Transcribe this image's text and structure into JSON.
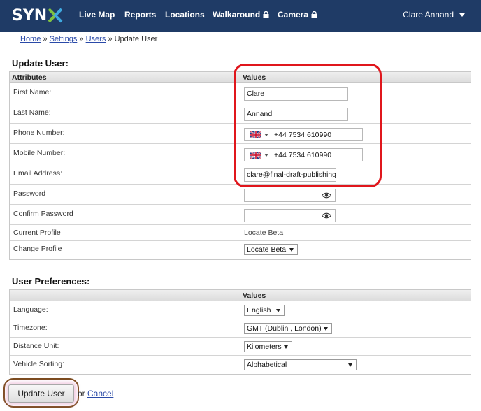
{
  "nav": {
    "logo_text": "SYN",
    "items": [
      "Live Map",
      "Reports",
      "Locations",
      "Walkaround",
      "Camera"
    ],
    "user": "Clare Annand",
    "colors": {
      "bar": "#1f3b66",
      "logo_x_green": "#7fc241",
      "logo_x_blue": "#3fa9e0"
    }
  },
  "breadcrumb": {
    "home": "Home",
    "sep": "»",
    "settings": "Settings",
    "users": "Users",
    "current": "Update User"
  },
  "update_user": {
    "title": "Update User:",
    "col_attributes": "Attributes",
    "col_values": "Values",
    "first_name": {
      "label": "First Name:",
      "value": "Clare"
    },
    "last_name": {
      "label": "Last Name:",
      "value": "Annand"
    },
    "phone": {
      "label": "Phone Number:",
      "value": "+44 7534 610990"
    },
    "mobile": {
      "label": "Mobile Number:",
      "value": "+44 7534 610990"
    },
    "email": {
      "label": "Email Address:",
      "value": "clare@final-draft-publishing"
    },
    "password": {
      "label": "Password",
      "value": ""
    },
    "confirm_password": {
      "label": "Confirm Password",
      "value": ""
    },
    "current_profile": {
      "label": "Current Profile",
      "value": "Locate Beta"
    },
    "change_profile": {
      "label": "Change Profile",
      "value": "Locate Beta"
    }
  },
  "prefs": {
    "title": "User Preferences:",
    "col_values": "Values",
    "language": {
      "label": "Language:",
      "value": "English"
    },
    "timezone": {
      "label": "Timezone:",
      "value": "GMT (Dublin , London)"
    },
    "distance": {
      "label": "Distance Unit:",
      "value": "Kilometers"
    },
    "sorting": {
      "label": "Vehicle Sorting:",
      "value": "Alphabetical"
    }
  },
  "footer": {
    "update_button": "Update User",
    "or": "or",
    "cancel": "Cancel"
  },
  "icons": [
    "lock-icon",
    "caret-down-icon",
    "uk-flag-icon",
    "eye-icon"
  ]
}
